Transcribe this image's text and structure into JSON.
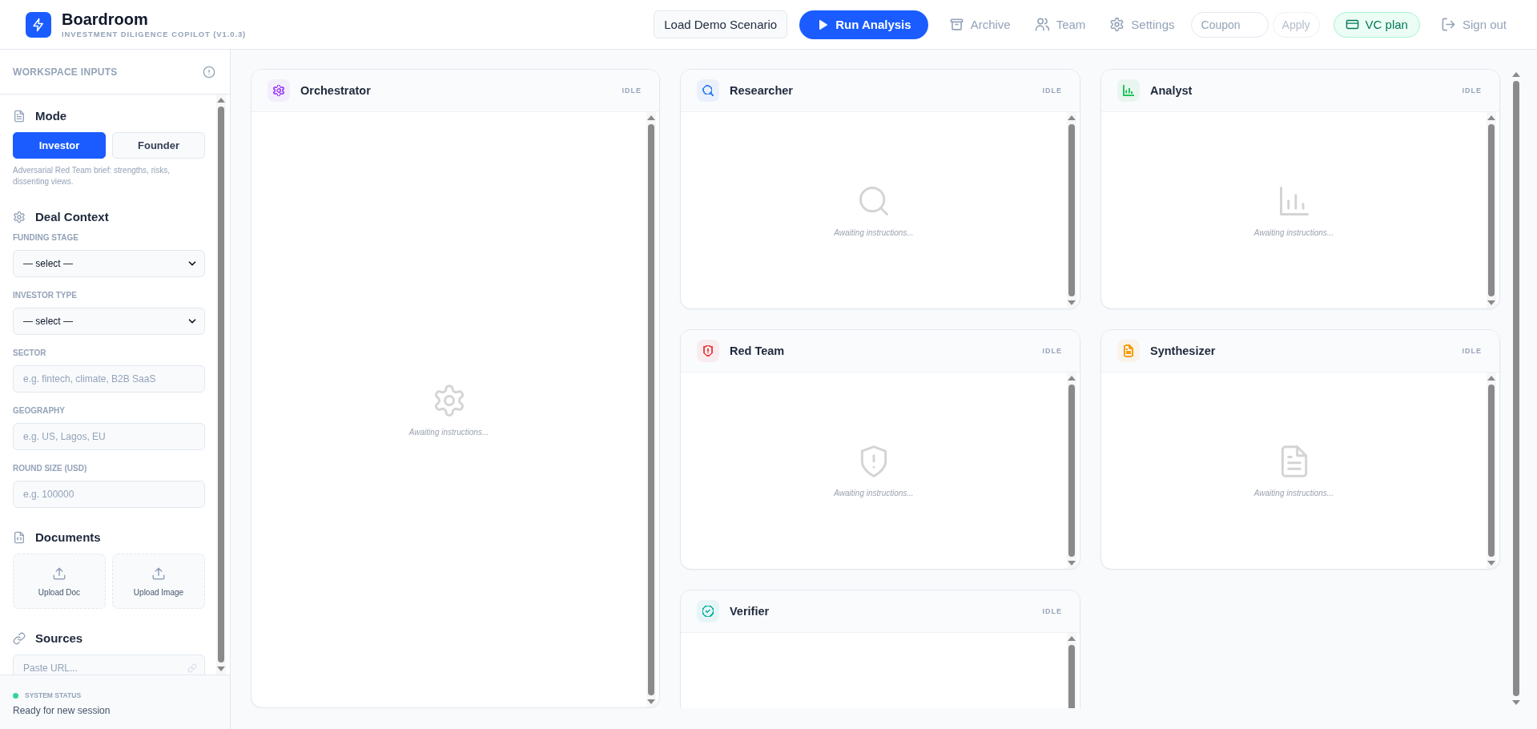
{
  "app": {
    "title": "Boardroom",
    "subtitle": "INVESTMENT DILIGENCE COPILOT (V1.0.3)"
  },
  "header_actions": [
    {
      "kind": "outline",
      "label": "Load Demo Scenario"
    },
    {
      "kind": "primary",
      "label": "Run Analysis"
    },
    {
      "kind": "link",
      "label": "Archive"
    },
    {
      "kind": "link",
      "label": "Team"
    },
    {
      "kind": "link",
      "label": "Settings"
    },
    {
      "kind": "field",
      "placeholder": "Coupon"
    },
    {
      "kind": "ghost",
      "label": "Apply",
      "disabled": true
    },
    {
      "kind": "plan",
      "label": "VC plan"
    },
    {
      "kind": "link",
      "label": "Sign out"
    }
  ],
  "sidebar": {
    "title": "WORKSPACE INPUTS",
    "sections": [
      {
        "kind": "mode",
        "heading": "Mode",
        "options": [
          {
            "label": "Investor",
            "selected": true
          },
          {
            "label": "Founder",
            "selected": false
          }
        ],
        "hint": "Adversarial Red Team brief: strengths, risks, dissenting views."
      },
      {
        "kind": "fields",
        "heading": "Deal Context",
        "fields": [
          {
            "kind": "select",
            "label": "FUNDING STAGE",
            "value": "— select —"
          },
          {
            "kind": "select",
            "label": "INVESTOR TYPE",
            "value": "— select —"
          },
          {
            "kind": "text",
            "label": "SECTOR",
            "placeholder": "e.g. fintech, climate, B2B SaaS"
          },
          {
            "kind": "text",
            "label": "GEOGRAPHY",
            "placeholder": "e.g. US, Lagos, EU"
          },
          {
            "kind": "text",
            "label": "ROUND SIZE (USD)",
            "placeholder": "e.g. 100000"
          }
        ]
      },
      {
        "kind": "uploads",
        "heading": "Documents",
        "items": [
          {
            "label": "Upload Doc"
          },
          {
            "label": "Upload Image"
          }
        ]
      },
      {
        "kind": "sources",
        "heading": "Sources",
        "placeholder": "Paste URL..."
      }
    ]
  },
  "status": {
    "label": "SYSTEM STATUS",
    "message": "Ready for new session"
  },
  "agents": [
    {
      "title": "Orchestrator",
      "status": "IDLE",
      "color": "#a855f7",
      "message": "Awaiting instructions..."
    },
    {
      "title": "Researcher",
      "status": "IDLE",
      "color": "#3b82f6",
      "message": "Awaiting instructions..."
    },
    {
      "title": "Analyst",
      "status": "IDLE",
      "color": "#22c55e",
      "message": "Awaiting instructions..."
    },
    {
      "title": "Red Team",
      "status": "IDLE",
      "color": "#ef4444",
      "message": "Awaiting instructions..."
    },
    {
      "title": "Synthesizer",
      "status": "IDLE",
      "color": "#f59e0b",
      "message": "Awaiting instructions..."
    },
    {
      "title": "Verifier",
      "status": "IDLE",
      "color": "#14b8a6"
    }
  ]
}
